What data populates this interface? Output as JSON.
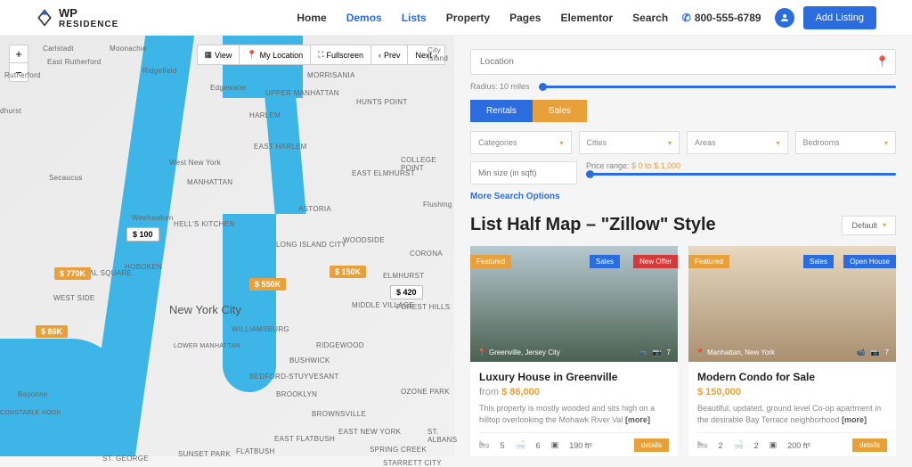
{
  "header": {
    "logo_top": "WP",
    "logo_bottom": "RESIDENCE",
    "nav": [
      "Home",
      "Demos",
      "Lists",
      "Property",
      "Pages",
      "Elementor",
      "Search"
    ],
    "active_nav": [
      1,
      2
    ],
    "phone": "800-555-6789",
    "add_listing": "Add Listing"
  },
  "map": {
    "toolbar": {
      "view": "View",
      "mylocation": "My Location",
      "fullscreen": "Fullscreen",
      "prev": "Prev",
      "next": "Next"
    },
    "labels": {
      "manhattan": "MANHATTAN",
      "brooklyn": "BROOKLYN",
      "nyc": "New York City",
      "harlem": "HARLEM",
      "astoria": "ASTORIA",
      "ridgewood": "RIDGEWOOD",
      "williamsburg": "WILLIAMSBURG",
      "hoboken": "Hoboken",
      "cityisland": "City Island",
      "flushing": "Flushing",
      "collegepoint": "COLLEGE POINT",
      "weehawken": "Weehawken",
      "westnewyork": "West New York",
      "morrisania": "MORRISANIA",
      "huntspoint": "HUNTS POINT",
      "eastharlem": "EAST HARLEM",
      "longislandcity": "LONG ISLAND CITY",
      "woodside": "WOODSIDE",
      "bushwick": "BUSHWICK",
      "ozonepark": "OZONE PARK",
      "foresthills": "FOREST HILLS",
      "rutherford": "Rutherford",
      "eastrutherford": "East Rutherford",
      "carlstadt": "Carlstadt",
      "secaucus": "Secaucus",
      "bayonne": "Bayonne",
      "moonachie": "Moonachie",
      "ridgefield": "Ridgefield",
      "edgewater": "Edgewater",
      "upperwest": "UPPER MANHATTAN",
      "westside": "WEST SIDE",
      "sthgeorge": "ST. GEORGE",
      "sunsetpark": "SUNSET PARK",
      "bedstuy": "BEDFORD-STUYVESANT",
      "eastflatbush": "EAST FLATBUSH",
      "brownsville": "BROWNSVILLE",
      "flatbush": "FLATBUSH",
      "eastny": "EAST NEW YORK",
      "stalbans": "ST. ALBANS",
      "springcreek": "SPRING CREEK",
      "starrett": "STARRETT CITY",
      "corona": "CORONA",
      "elmhurst": "ELMHURST",
      "eastelmhurst": "EAST ELMHURST",
      "middlevillage": "MIDDLE VILLAGE",
      "hellskitchen": "HELL'S KITCHEN",
      "lowerman": "LOWER MANHATTAN",
      "constablehook": "CONSTABLE HOOK",
      "dhurst": "dhurst",
      "alsquare": "AL SQUARE"
    },
    "markers": {
      "m100": "$ 100",
      "m770": "$ 770K",
      "m86": "$ 86K",
      "m550": "$ 550K",
      "m150": "$ 150K",
      "m420": "$ 420"
    }
  },
  "search": {
    "location_ph": "Location",
    "radius": "Radius: 10 miles",
    "tabs": {
      "rentals": "Rentals",
      "sales": "Sales"
    },
    "filters": {
      "categories": "Categories",
      "cities": "Cities",
      "areas": "Areas",
      "bedrooms": "Bedrooms"
    },
    "min_size_ph": "Min size (in sqft)",
    "price_range_label": "Price range:",
    "price_range_val": "$ 0 to $ 1,000",
    "more": "More Search Options"
  },
  "listing": {
    "title": "List Half Map – \"Zillow\" Style",
    "default": "Default",
    "cards": [
      {
        "badges": {
          "featured": "Featured",
          "sales": "Sales",
          "offer": "New Offer"
        },
        "location": "Greenville, Jersey City",
        "photo_count": "7",
        "title": "Luxury House in Greenville",
        "from": "from",
        "price": "$ 86,000",
        "desc": "This property is mostly wooded and sits high on a hilltop overlooking the Mohawk River Val",
        "more": "[more]",
        "beds": "5",
        "baths": "6",
        "sqft": "190 ft²",
        "details": "details"
      },
      {
        "badges": {
          "featured": "Featured",
          "sales": "Sales",
          "offer": "Open House"
        },
        "location": "Manhattan, New York",
        "photo_count": "7",
        "title": "Modern Condo for Sale",
        "from": "",
        "price": "$ 150,000",
        "desc": "Beautiful, updated, ground level Co-op apartment in the desirable Bay Terrace neighborhood",
        "more": "[more]",
        "beds": "2",
        "baths": "2",
        "sqft": "200 ft²",
        "details": "details"
      }
    ]
  }
}
